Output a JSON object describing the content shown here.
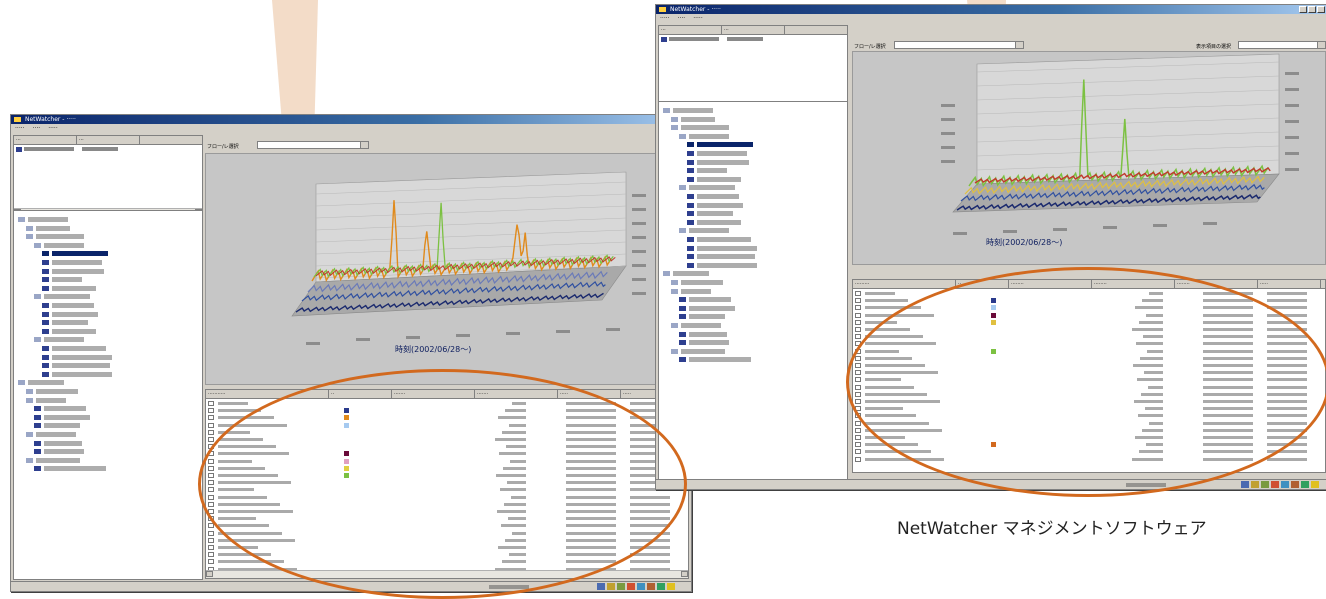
{
  "caption": "NetWatcher マネジメントソフトウェア",
  "left_window": {
    "axis_title": "時刻(2002/06/28〜)",
    "combo_label": "フロー/レ選択"
  },
  "right_window": {
    "axis_title": "時刻(2002/06/28〜)",
    "combo_label": "フロー/レ選択",
    "display_select_label": "表示項目の選択"
  },
  "colors": {
    "wedge": "#f2d9c4",
    "highlight_ellipse": "#d2691e",
    "chart_spike_orange": "#e08a1c",
    "chart_spike_green": "#7cc142",
    "chart_floor_blue": "#2a3a8c",
    "tree_icon_blue": "#2e3f8f"
  },
  "icons": [
    "window-app-icon",
    "tree-folder-icon",
    "graph-node-icon",
    "tray-icon"
  ]
}
